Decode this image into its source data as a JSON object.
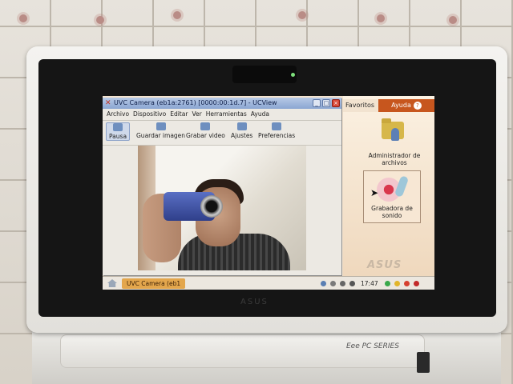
{
  "window": {
    "title": "UVC Camera (eb1a:2761) [0000:00:1d.7] - UCView",
    "menu": [
      "Archivo",
      "Dispositivo",
      "Editar",
      "Ver",
      "Herramientas",
      "Ayuda"
    ],
    "toolbar": [
      "Pausa",
      "Guardar imagen",
      "Grabar video",
      "Ajustes",
      "Preferencias"
    ],
    "controls": [
      "_",
      "□",
      "×"
    ]
  },
  "launcher": {
    "tab_favorites": "Favoritos",
    "tab_help": "Ayuda",
    "help_icon": "?",
    "file_manager_label": "Administrador de archivos",
    "sound_recorder_label": "Grabadora de sonido",
    "brand_logo": "ASUS"
  },
  "taskbar": {
    "task_label": "UVC Camera (eb1",
    "clock": "17:47"
  },
  "device": {
    "brand": "ASUS",
    "series": "Eee PC SERIES"
  },
  "colors": {
    "accent": "#c7561e",
    "titlebar": "#8ba6d2",
    "task": "#e3a64c"
  }
}
